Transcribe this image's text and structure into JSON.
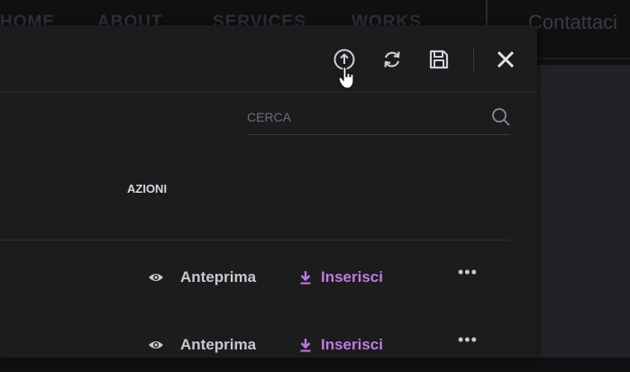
{
  "site_nav": {
    "items": [
      "HOME",
      "ABOUT",
      "SERVICES",
      "WORKS"
    ],
    "contact_label": "Contattaci"
  },
  "modal": {
    "toolbar": {
      "upload_icon": "upload-circle-icon",
      "refresh_icon": "refresh-icon",
      "save_icon": "floppy-save-icon",
      "close_icon": "close-icon"
    },
    "search": {
      "placeholder": "CERCA",
      "value": ""
    },
    "table": {
      "column_header": "AZIONI",
      "rows": [
        {
          "preview_label": "Anteprima",
          "insert_label": "Inserisci",
          "more_label": "•••"
        },
        {
          "preview_label": "Anteprima",
          "insert_label": "Inserisci",
          "more_label": "•••"
        }
      ]
    }
  },
  "colors": {
    "modal_bg": "#1c1c1f",
    "accent_insert": "#c07ae0",
    "text": "#c9c9cd"
  }
}
